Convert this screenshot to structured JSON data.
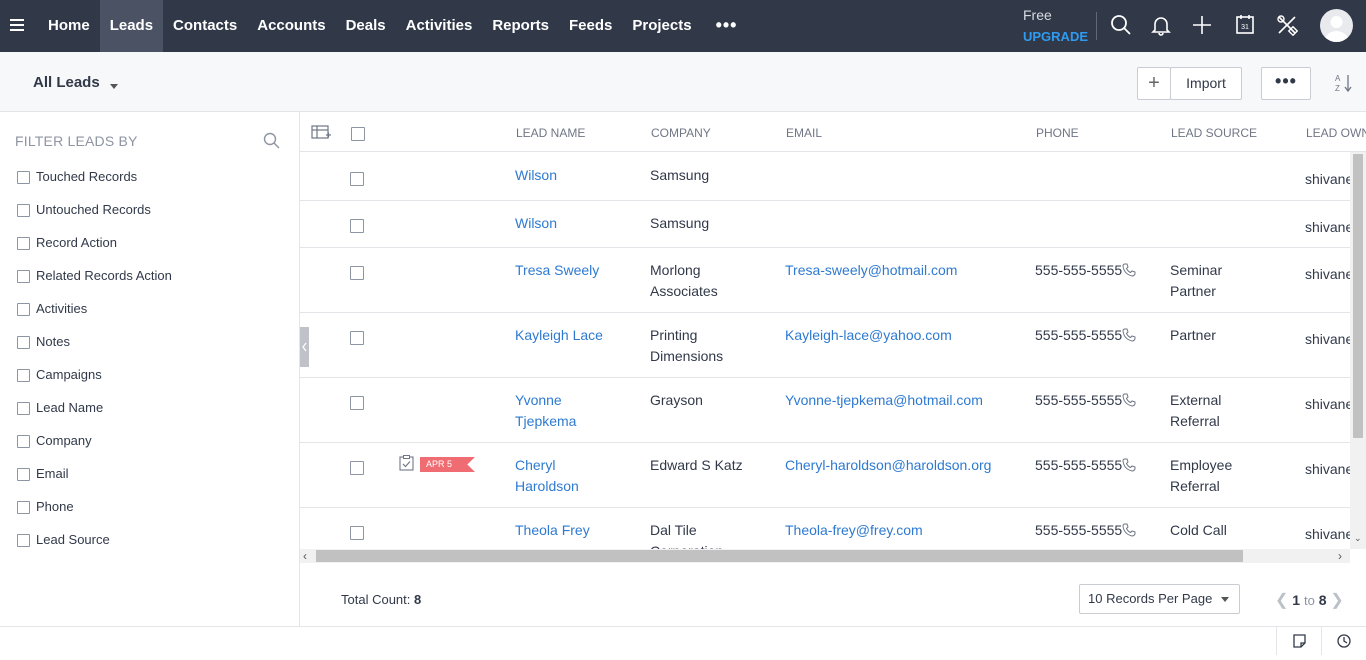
{
  "nav": {
    "items": [
      "Home",
      "Leads",
      "Contacts",
      "Accounts",
      "Deals",
      "Activities",
      "Reports",
      "Feeds",
      "Projects"
    ],
    "active": "Leads",
    "more": "•••",
    "plan": "Free",
    "upgrade": "UPGRADE",
    "icons": [
      "search-icon",
      "bell-icon",
      "plus-icon",
      "calendar-icon",
      "tools-icon"
    ],
    "calendar_day": "31"
  },
  "subheader": {
    "view": "All Leads",
    "plus_label": "+",
    "import_label": "Import",
    "more_label": "•••"
  },
  "filters": {
    "title": "FILTER LEADS BY",
    "items": [
      "Touched Records",
      "Untouched Records",
      "Record Action",
      "Related Records Action",
      "Activities",
      "Notes",
      "Campaigns",
      "Lead Name",
      "Company",
      "Email",
      "Phone",
      "Lead Source"
    ]
  },
  "table": {
    "headers": {
      "lead_name": "LEAD NAME",
      "company": "COMPANY",
      "email": "EMAIL",
      "phone": "PHONE",
      "lead_source": "LEAD SOURCE",
      "lead_owner": "LEAD OWN"
    },
    "rows": [
      {
        "name": "Wilson",
        "company": "Samsung",
        "email": "",
        "phone": "",
        "source": "",
        "owner": "shivane"
      },
      {
        "name": "Wilson",
        "company": "Samsung",
        "email": "",
        "phone": "",
        "source": "",
        "owner": "shivane"
      },
      {
        "name": "Tresa Sweely",
        "company": "Morlong Associates",
        "email": "Tresa-sweely@hotmail.com",
        "phone": "555-555-5555",
        "source": "Seminar Partner",
        "owner": "shivane"
      },
      {
        "name": "Kayleigh Lace",
        "company": "Printing Dimensions",
        "email": "Kayleigh-lace@yahoo.com",
        "phone": "555-555-5555",
        "source": "Partner",
        "owner": "shivane"
      },
      {
        "name": "Yvonne Tjepkema",
        "company": "Grayson",
        "email": "Yvonne-tjepkema@hotmail.com",
        "phone": "555-555-5555",
        "source": "External Referral",
        "owner": "shivane"
      },
      {
        "name": "Cheryl Haroldson",
        "company": "Edward S Katz",
        "email": "Cheryl-haroldson@haroldson.org",
        "phone": "555-555-5555",
        "source": "Employee Referral",
        "owner": "shivane"
      },
      {
        "name": "Theola Frey",
        "company": "Dal Tile Corporation",
        "email": "Theola-frey@frey.com",
        "phone": "555-555-5555",
        "source": "Cold Call",
        "owner": "shivane"
      }
    ],
    "task_badge": "APR 5"
  },
  "footer": {
    "total_label": "Total Count:",
    "total_value": "8",
    "per_page": "10 Records Per Page",
    "page_from": "1",
    "page_to_word": "to",
    "page_to": "8"
  },
  "colors": {
    "topbar": "#313949",
    "link": "#2e7ad1",
    "upgrade": "#2f9bf0",
    "badge": "#ef6d72"
  }
}
